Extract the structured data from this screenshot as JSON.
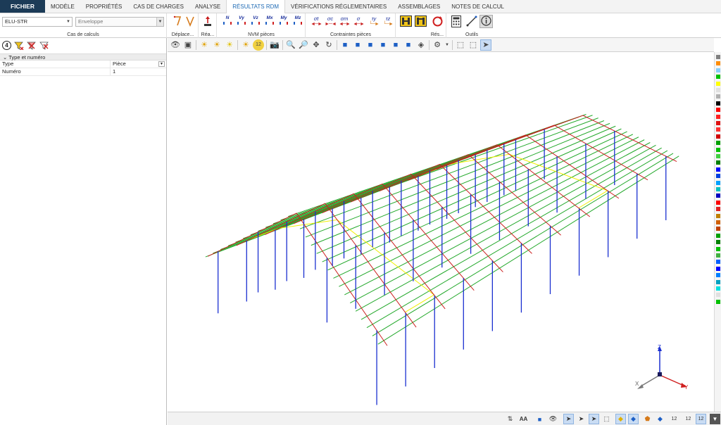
{
  "tabs": {
    "file": "FICHIER",
    "items": [
      "MODÈLE",
      "PROPRIÉTÉS",
      "CAS DE CHARGES",
      "ANALYSE",
      "RÉSULTATS RDM",
      "VÉRIFICATIONS RÉGLEMENTAIRES",
      "ASSEMBLAGES",
      "NOTES DE CALCUL"
    ],
    "active": "RÉSULTATS RDM"
  },
  "ribbon": {
    "load_case": {
      "combo_value": "ELU-STR",
      "envelope_value": "Enveloppe",
      "group_label": "Cas de calculs"
    },
    "displacements": {
      "group_label": "Déplace..."
    },
    "reactions": {
      "group_label": "Réa..."
    },
    "nvm": {
      "group_label": "NVM pièces",
      "buttons": [
        "N",
        "Vy",
        "Vz",
        "Mx",
        "My",
        "Mz"
      ]
    },
    "stresses": {
      "group_label": "Contraintes pièces",
      "buttons": [
        "σt",
        "σc",
        "σm",
        "σ",
        "τy",
        "τz"
      ]
    },
    "results": {
      "group_label": "Rés..."
    },
    "tools": {
      "group_label": "Outils"
    }
  },
  "left_panel": {
    "badge": "4",
    "section_title": "Type et numéro",
    "rows": [
      {
        "key": "Type",
        "value": "Pièce"
      },
      {
        "key": "Numéro",
        "value": "1"
      }
    ]
  },
  "view_toolbar": {
    "badge": "12"
  },
  "axes": {
    "x": "X",
    "y": "Y",
    "z": "Z"
  },
  "bottom_toolbar": {
    "text_size_label": "AA",
    "badge": "12"
  },
  "colors": {
    "purlin": "#22a82a",
    "rafter": "#cc1f1f",
    "column": "#1a2fd0",
    "bracing": "#f0f000",
    "accent": "#1c3b57"
  },
  "color_strip": [
    "#808080",
    "#ff8c00",
    "#87cefa",
    "#00c000",
    "#ffff00",
    "#e0e0e0",
    "#b0b0b0",
    "#000000",
    "#ff0000",
    "#ff2020",
    "#e01010",
    "#ff3030",
    "#d00000",
    "#00a000",
    "#00c000",
    "#40d040",
    "#008000",
    "#0000ff",
    "#0040e0",
    "#00a0ff",
    "#00c0c0",
    "#0000c0",
    "#ff0000",
    "#e02020",
    "#c08000",
    "#d06000",
    "#c04000",
    "#00a000",
    "#008000",
    "#00c000",
    "#40b040",
    "#0060ff",
    "#0000ff",
    "#0080ff",
    "#00a0c0",
    "#00e0e0",
    "#e0e0e0",
    "#00c000"
  ]
}
